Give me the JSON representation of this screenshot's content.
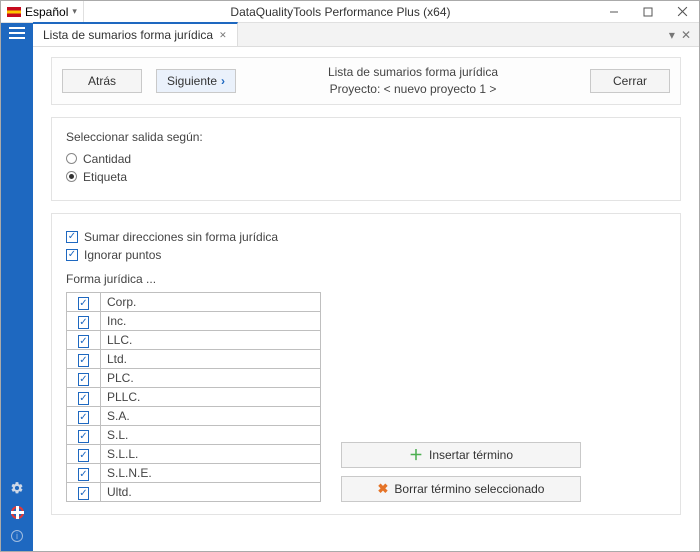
{
  "titlebar": {
    "language": "Español",
    "app_title": "DataQualityTools Performance Plus (x64)"
  },
  "tab": {
    "label": "Lista de sumarios forma jurídica"
  },
  "header": {
    "back": "Atrás",
    "next": "Siguiente",
    "close": "Cerrar",
    "title": "Lista de sumarios forma jurídica",
    "project": "Proyecto: < nuevo proyecto 1 >"
  },
  "group1": {
    "label": "Seleccionar salida según:",
    "opt_quantity": "Cantidad",
    "opt_label": "Etiqueta"
  },
  "group2": {
    "sum_addr": "Sumar direcciones sin forma jurídica",
    "ignore_dots": "Ignorar puntos",
    "table_label": "Forma jurídica ...",
    "rows": [
      "Corp.",
      "Inc.",
      "LLC.",
      "Ltd.",
      "PLC.",
      "PLLC.",
      "S.A.",
      "S.L.",
      "S.L.L.",
      "S.L.N.E.",
      "Ultd."
    ],
    "insert": "Insertar término",
    "delete": "Borrar término seleccionado"
  }
}
